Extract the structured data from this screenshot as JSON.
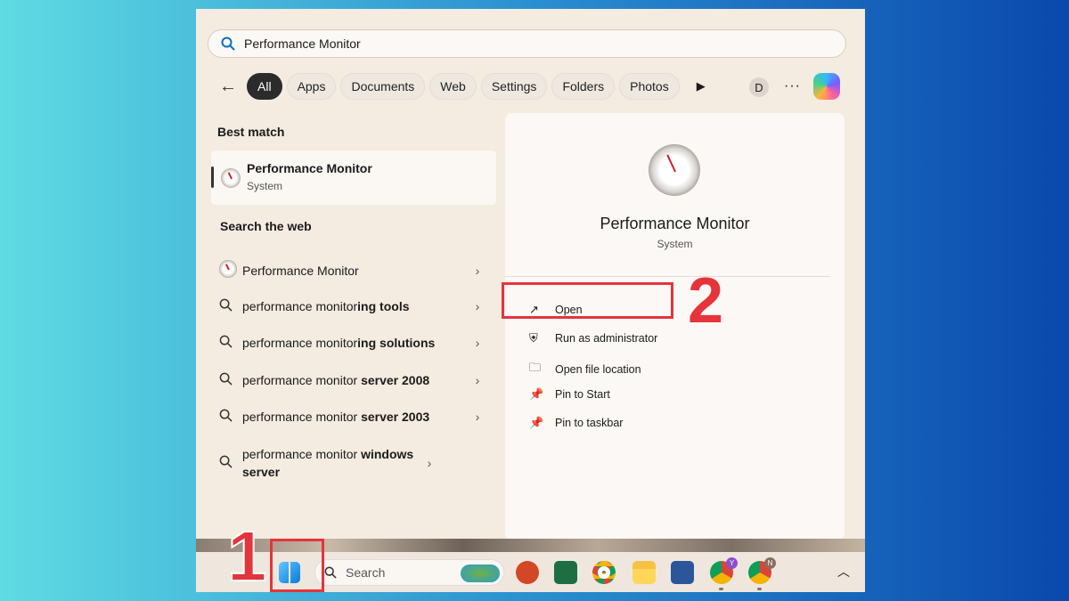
{
  "search": {
    "query": "Performance Monitor"
  },
  "filters": [
    "All",
    "Apps",
    "Documents",
    "Web",
    "Settings",
    "Folders",
    "Photos"
  ],
  "active_filter": "All",
  "account_initial": "D",
  "best_match": {
    "heading": "Best match",
    "title": "Performance Monitor",
    "subtitle": "System"
  },
  "web": {
    "heading": "Search the web",
    "items": [
      {
        "normal": "Performance Monitor",
        "bold": "",
        "icon": "app-gauge-icon"
      },
      {
        "normal": "performance monitor",
        "bold": "ing tools",
        "icon": "search-icon"
      },
      {
        "normal": "performance monitor",
        "bold": "ing solutions",
        "icon": "search-icon"
      },
      {
        "normal": "performance monitor ",
        "bold": "server 2008",
        "icon": "search-icon"
      },
      {
        "normal": "performance monitor ",
        "bold": "server 2003",
        "icon": "search-icon"
      },
      {
        "normal": "performance monitor ",
        "bold": "windows server",
        "icon": "search-icon"
      }
    ]
  },
  "details": {
    "title": "Performance Monitor",
    "subtitle": "System",
    "actions": [
      {
        "label": "Open",
        "icon": "open-external-icon"
      },
      {
        "label": "Run as administrator",
        "icon": "shield-icon"
      },
      {
        "label": "Open file location",
        "icon": "folder-icon"
      },
      {
        "label": "Pin to Start",
        "icon": "pin-icon"
      },
      {
        "label": "Pin to taskbar",
        "icon": "pin-icon"
      }
    ]
  },
  "annotations": {
    "step1": "1",
    "step2": "2",
    "color": "#e5343b"
  },
  "taskbar": {
    "search_placeholder": "Search",
    "badges": [
      "Y",
      "N"
    ]
  }
}
